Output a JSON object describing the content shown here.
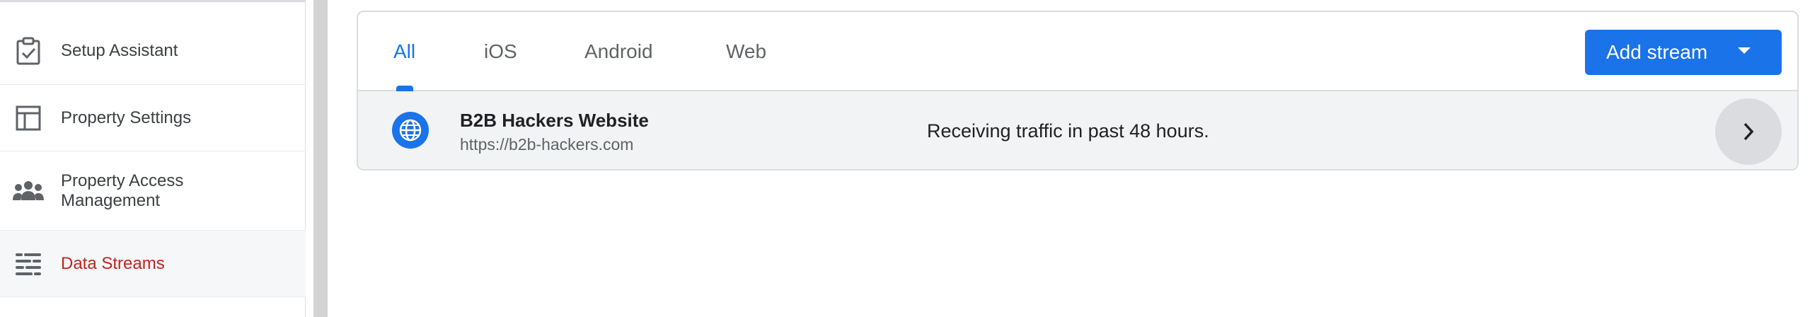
{
  "sidebar": {
    "items": [
      {
        "label": "Setup Assistant",
        "icon": "clipboard-check-icon"
      },
      {
        "label": "Property Settings",
        "icon": "layout-icon"
      },
      {
        "label": "Property Access Management",
        "label_line1": "Property Access",
        "label_line2": "Management",
        "icon": "people-icon"
      },
      {
        "label": "Data Streams",
        "icon": "data-streams-icon",
        "active": true
      }
    ]
  },
  "tabs": [
    {
      "label": "All",
      "active": true
    },
    {
      "label": "iOS"
    },
    {
      "label": "Android"
    },
    {
      "label": "Web"
    }
  ],
  "toolbar": {
    "add_stream_label": "Add stream"
  },
  "streams": [
    {
      "name": "B2B Hackers Website",
      "url": "https://b2b-hackers.com",
      "status": "Receiving traffic in past 48 hours.",
      "icon": "globe-icon"
    }
  ],
  "colors": {
    "accent": "#1a73e8",
    "active_nav": "#c5221f"
  }
}
